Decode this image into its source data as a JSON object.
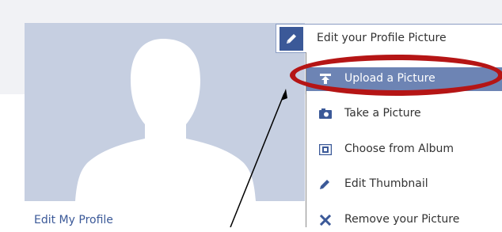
{
  "profile": {
    "edit_my_profile_label": "Edit My Profile"
  },
  "edit_picture_button": {
    "label": "Edit your Profile Picture",
    "icon": "pencil-icon"
  },
  "menu": {
    "items": [
      {
        "label": "Upload a Picture",
        "icon": "upload-icon",
        "selected": true
      },
      {
        "label": "Take a Picture",
        "icon": "camera-icon",
        "selected": false
      },
      {
        "label": "Choose from Album",
        "icon": "album-icon",
        "selected": false
      },
      {
        "label": "Edit Thumbnail",
        "icon": "pencil-icon",
        "selected": false
      },
      {
        "label": "Remove your Picture",
        "icon": "x-icon",
        "selected": false
      }
    ]
  },
  "colors": {
    "brand_blue": "#3b5998",
    "selected_bg": "#6d84b4",
    "highlight_ring": "#b51515",
    "placeholder_bg": "#c6cfe1"
  }
}
